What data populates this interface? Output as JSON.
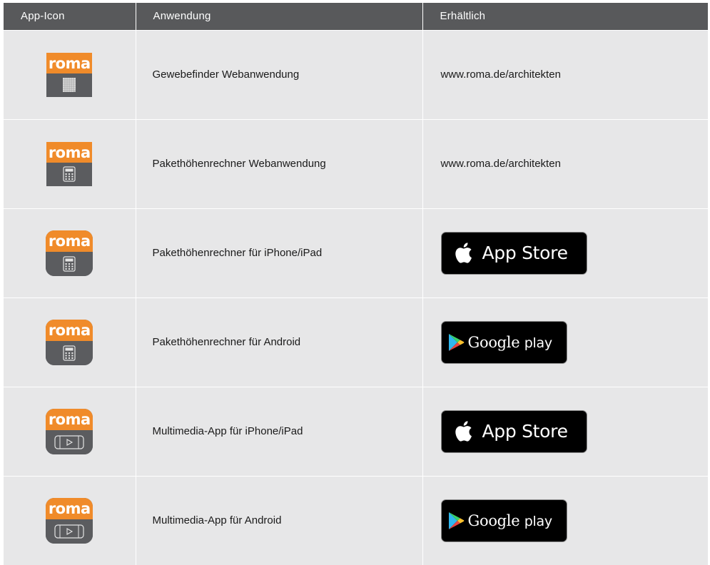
{
  "headers": {
    "icon": "App-Icon",
    "app": "Anwendung",
    "availability": "Erhältlich"
  },
  "brand": {
    "logo_text": "roma",
    "orange": "#f08b2a",
    "gray": "#5b5c5f"
  },
  "rows": [
    {
      "icon_symbol": "fabric-swatch-icon",
      "icon_shape": "square",
      "name": "Gewebefinder Webanwendung",
      "availability": "www.roma.de/architekten",
      "store": "web"
    },
    {
      "icon_symbol": "calculator-icon",
      "icon_shape": "square",
      "name": "Pakethöhenrechner Webanwendung",
      "availability": "www.roma.de/architekten",
      "store": "web"
    },
    {
      "icon_symbol": "calculator-icon",
      "icon_shape": "rounded",
      "name": "Pakethöhenrechner für iPhone/iPad",
      "availability": "App Store",
      "store": "appstore"
    },
    {
      "icon_symbol": "calculator-icon",
      "icon_shape": "rounded",
      "name": "Pakethöhenrechner für Android",
      "availability": "Google play",
      "store": "play"
    },
    {
      "icon_symbol": "media-player-icon",
      "icon_shape": "rounded",
      "name": "Multimedia-App für iPhone/iPad",
      "availability": "App Store",
      "store": "appstore"
    },
    {
      "icon_symbol": "media-player-icon",
      "icon_shape": "rounded",
      "name": "Multimedia-App für Android",
      "availability": "Google play",
      "store": "play"
    }
  ],
  "badges": {
    "appstore_label": "App Store",
    "google_word": "Google",
    "play_word": "play"
  }
}
